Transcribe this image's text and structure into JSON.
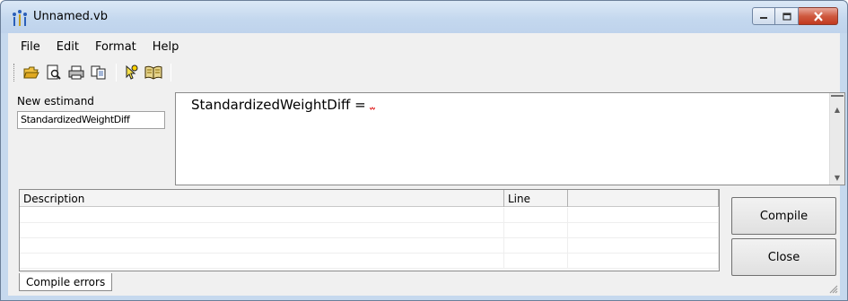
{
  "window": {
    "title": "Unnamed.vb",
    "controls": {
      "minimize": "minimize-icon",
      "maximize": "maximize-icon",
      "close": "close-icon"
    }
  },
  "menu": {
    "items": [
      {
        "label": "File"
      },
      {
        "label": "Edit"
      },
      {
        "label": "Format"
      },
      {
        "label": "Help"
      }
    ]
  },
  "toolbar": {
    "icons": [
      "open-folder-icon",
      "print-preview-icon",
      "print-icon",
      "copy-icon",
      "help-pointer-icon",
      "book-icon"
    ]
  },
  "estimand": {
    "label": "New estimand",
    "value": "StandardizedWeightDiff"
  },
  "editor": {
    "text": "StandardizedWeightDiff ="
  },
  "errors_grid": {
    "columns": [
      {
        "label": "Description"
      },
      {
        "label": "Line"
      },
      {
        "label": ""
      }
    ],
    "rows": [
      [],
      [],
      [],
      [],
      []
    ]
  },
  "tabs": [
    {
      "label": "Compile errors",
      "active": true
    }
  ],
  "buttons": {
    "compile": "Compile",
    "close": "Close"
  },
  "colors": {
    "title_gradient_top": "#dbe8f6",
    "frame": "#c6d9ee",
    "close_button": "#c1391f",
    "client_bg": "#f0f0f0"
  }
}
